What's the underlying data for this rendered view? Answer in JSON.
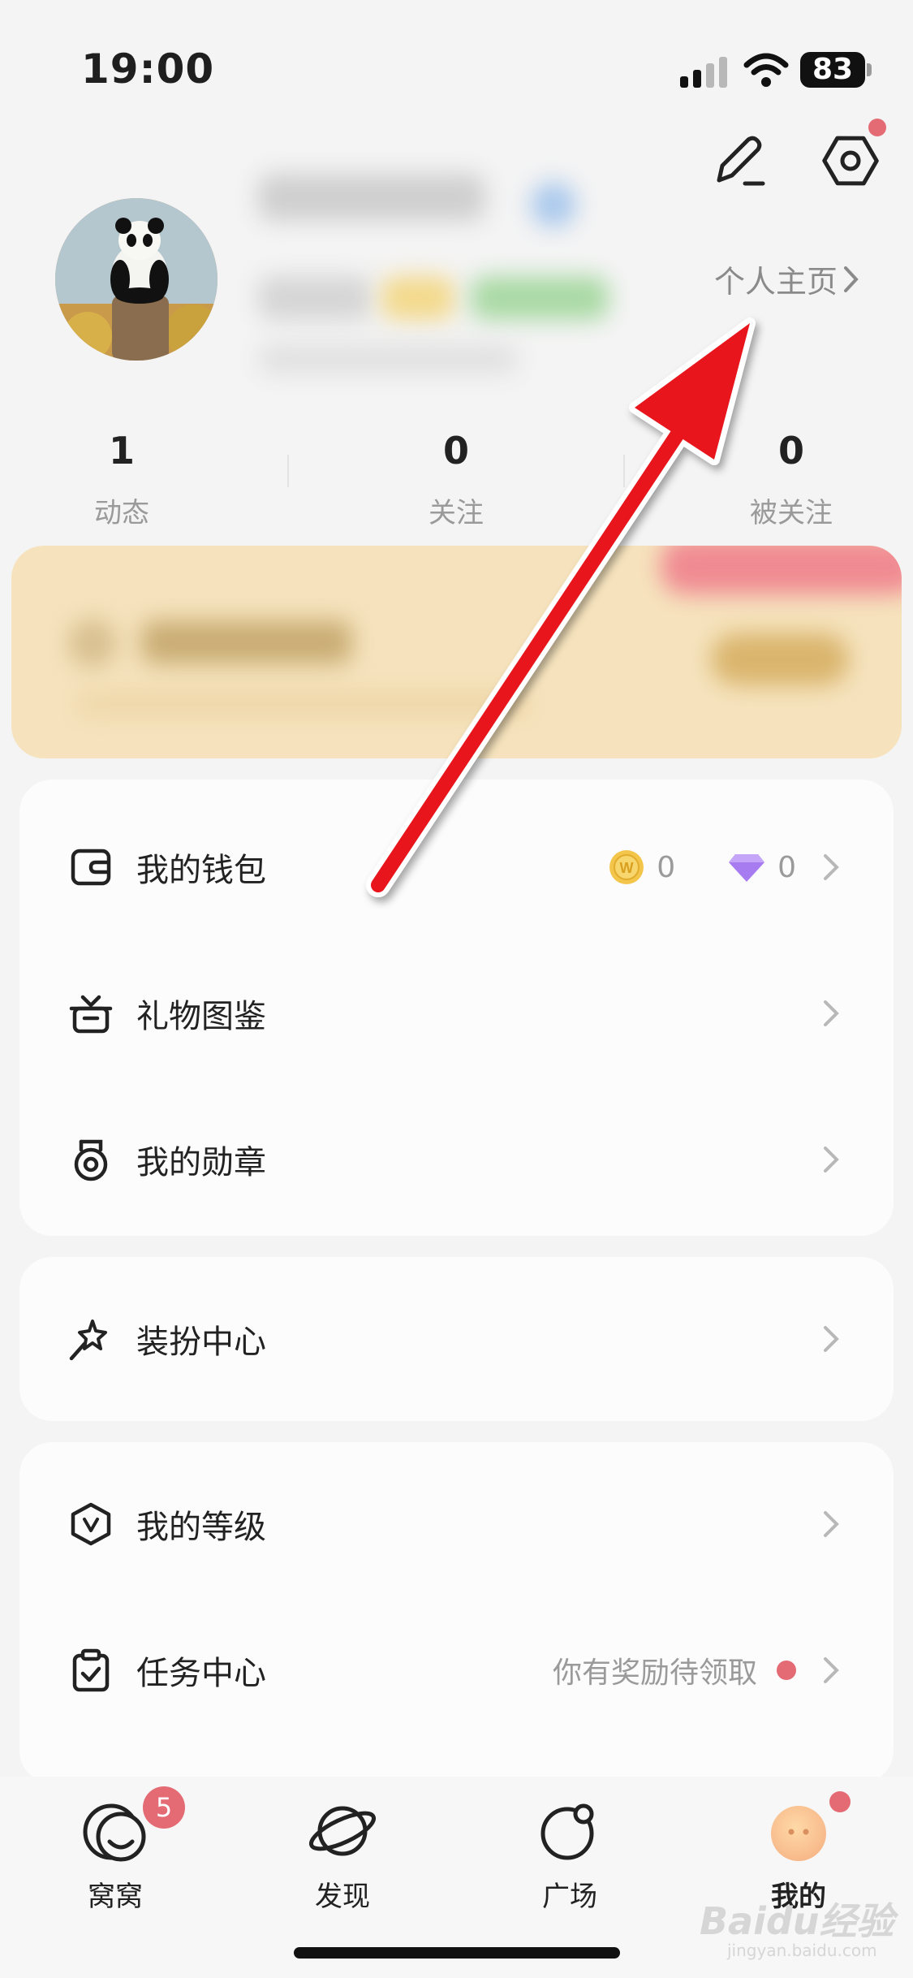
{
  "status_bar": {
    "time": "19:00",
    "battery": "83"
  },
  "profile": {
    "homepage_link": "个人主页"
  },
  "stats": [
    {
      "value": "1",
      "label": "动态"
    },
    {
      "value": "0",
      "label": "关注"
    },
    {
      "value": "0",
      "label": "被关注"
    }
  ],
  "menu_card_1": {
    "wallet": {
      "label": "我的钱包",
      "coins": "0",
      "diamonds": "0"
    },
    "gifts": {
      "label": "礼物图鉴"
    },
    "medals": {
      "label": "我的勋章"
    }
  },
  "menu_card_2": {
    "dressup": {
      "label": "装扮中心"
    }
  },
  "menu_card_3": {
    "level": {
      "label": "我的等级"
    },
    "tasks": {
      "label": "任务中心",
      "hint": "你有奖励待领取"
    }
  },
  "tabs": [
    {
      "label": "窝窝",
      "badge": "5"
    },
    {
      "label": "发现"
    },
    {
      "label": "广场"
    },
    {
      "label": "我的"
    }
  ],
  "watermark": {
    "brand": "Baidu经验",
    "site": "jingyan.baidu.com"
  },
  "colors": {
    "accent_red": "#e46a73",
    "banner_gold": "#f6e3bd",
    "arrow_red": "#e8131b",
    "coin_gold": "#f3c64b",
    "diamond_purple": "#a77cf0"
  }
}
